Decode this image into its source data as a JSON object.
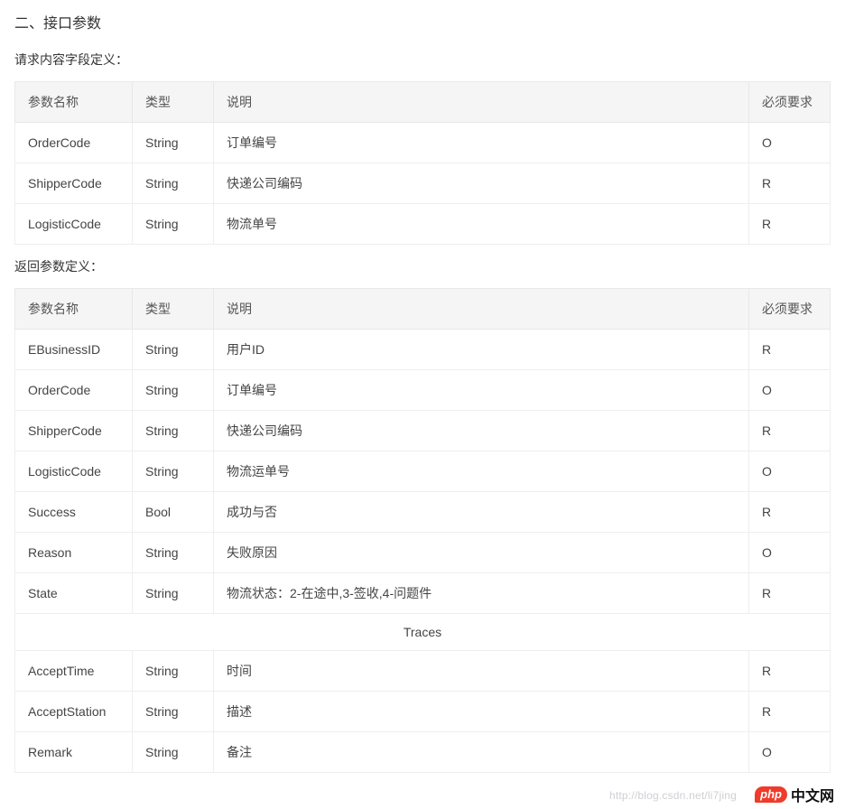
{
  "section_title": "二、接口参数",
  "request": {
    "subtitle": "请求内容字段定义：",
    "headers": {
      "name": "参数名称",
      "type": "类型",
      "desc": "说明",
      "req": "必须要求"
    },
    "rows": [
      {
        "name": "OrderCode",
        "type": "String",
        "desc": "订单编号",
        "req": "O"
      },
      {
        "name": "ShipperCode",
        "type": "String",
        "desc": "快递公司编码",
        "req": "R"
      },
      {
        "name": "LogisticCode",
        "type": "String",
        "desc": "物流单号",
        "req": "R"
      }
    ]
  },
  "response": {
    "subtitle": "返回参数定义：",
    "headers": {
      "name": "参数名称",
      "type": "类型",
      "desc": "说明",
      "req": "必须要求"
    },
    "rows": [
      {
        "name": "EBusinessID",
        "type": "String",
        "desc": "用户ID",
        "req": "R"
      },
      {
        "name": "OrderCode",
        "type": "String",
        "desc": "订单编号",
        "req": "O"
      },
      {
        "name": "ShipperCode",
        "type": "String",
        "desc": "快递公司编码",
        "req": "R"
      },
      {
        "name": "LogisticCode",
        "type": "String",
        "desc": "物流运单号",
        "req": "O"
      },
      {
        "name": "Success",
        "type": "Bool",
        "desc": "成功与否",
        "req": "R"
      },
      {
        "name": "Reason",
        "type": "String",
        "desc": "失败原因",
        "req": "O"
      },
      {
        "name": "State",
        "type": "String",
        "desc": "物流状态：2-在途中,3-签收,4-问题件",
        "req": "R"
      }
    ],
    "traces_label": "Traces",
    "traces_rows": [
      {
        "name": "AcceptTime",
        "type": "String",
        "desc": "时间",
        "req": "R"
      },
      {
        "name": "AcceptStation",
        "type": "String",
        "desc": "描述",
        "req": "R"
      },
      {
        "name": "Remark",
        "type": "String",
        "desc": "备注",
        "req": "O"
      }
    ]
  },
  "watermark": "http://blog.csdn.net/li7jing",
  "brand": {
    "logo": "php",
    "text": "中文网"
  }
}
